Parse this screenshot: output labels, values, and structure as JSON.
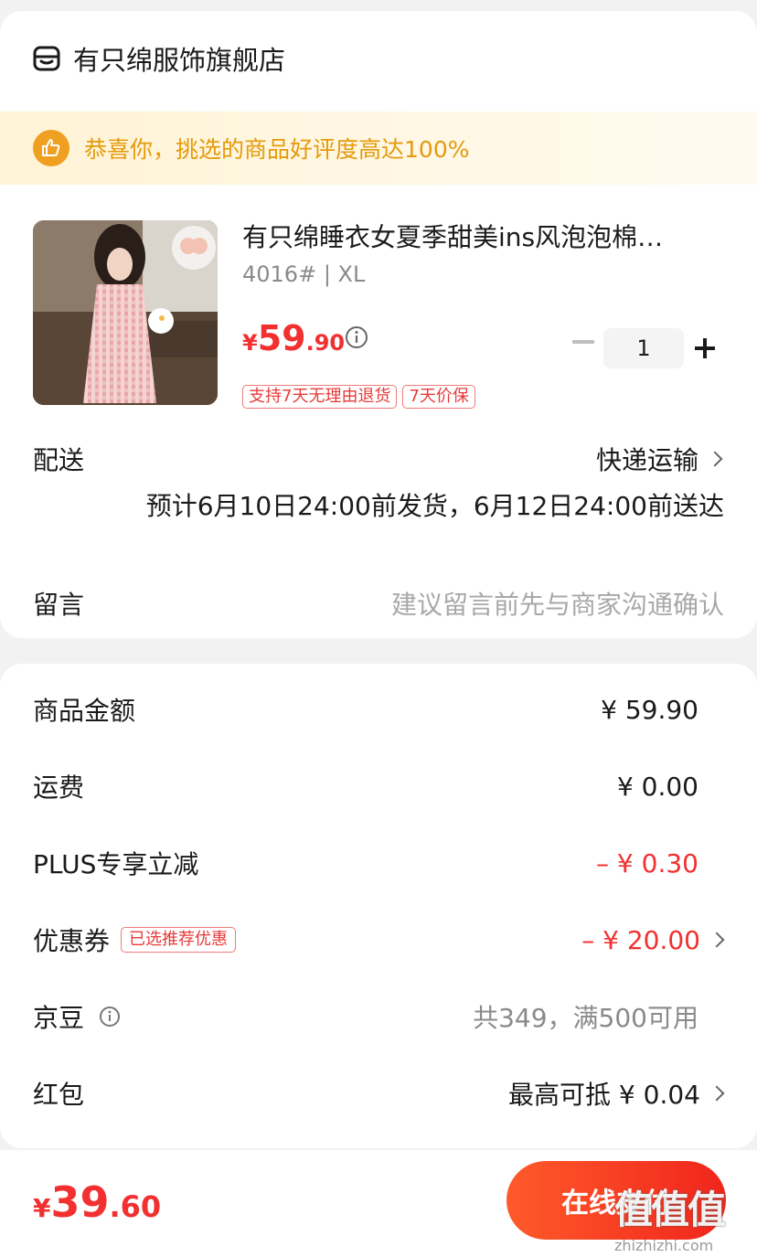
{
  "shop": {
    "name": "有只绵服饰旗舰店",
    "icon": "store-icon"
  },
  "banner": {
    "text": "恭喜你，挑选的商品好评度高达100%",
    "icon": "thumbs-up-icon"
  },
  "product": {
    "title": "有只绵睡衣女夏季甜美ins风泡泡棉…",
    "sku": "4016# | XL",
    "price_currency": "¥",
    "price_int": "59",
    "price_dec": ".90",
    "quantity": "1",
    "tags": [
      "支持7天无理由退货",
      "7天价保"
    ]
  },
  "delivery": {
    "label": "配送",
    "method": "快递运输",
    "eta": "预计6月10日24:00前发货，6月12日24:00前送达"
  },
  "note": {
    "label": "留言",
    "placeholder": "建议留言前先与商家沟通确认"
  },
  "summary": {
    "goods_label": "商品金额",
    "goods_value": "¥ 59.90",
    "shipping_label": "运费",
    "shipping_value": "¥ 0.00",
    "plus_label": "PLUS专享立减",
    "plus_value": "– ¥ 0.30",
    "coupon_label": "优惠券",
    "coupon_tag": "已选推荐优惠",
    "coupon_value": "– ¥ 20.00",
    "jd_label": "京豆",
    "jd_value": "共349，满500可用",
    "redpack_label": "红包",
    "redpack_value": "最高可抵 ¥ 0.04"
  },
  "bottom": {
    "total_currency": "¥",
    "total_int": "39",
    "total_dec": ".60",
    "pay_label": "在线支付"
  },
  "watermark": {
    "logo": "值值值",
    "url": "zhizhizhi.com"
  },
  "colors": {
    "accent_red": "#f23030",
    "banner_orange": "#e59a0b",
    "banner_bg": "#fff3d6"
  }
}
